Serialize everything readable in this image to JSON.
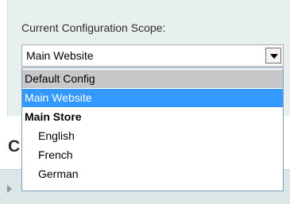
{
  "scope": {
    "label": "Current Configuration Scope:",
    "selected": "Main Website",
    "options": [
      "Default Config",
      "Main Website",
      "Main Store",
      "English",
      "French",
      "German"
    ]
  },
  "page": {
    "heading_fragment": "C"
  },
  "colors": {
    "panel_bg": "#e7efef",
    "highlight": "#3399ff",
    "default_option_bg": "#c8c8c8",
    "section_bar_bg": "#dde6e6"
  },
  "icons": {
    "select_arrow": "chevron-down-icon",
    "section_toggle": "triangle-right-icon"
  }
}
